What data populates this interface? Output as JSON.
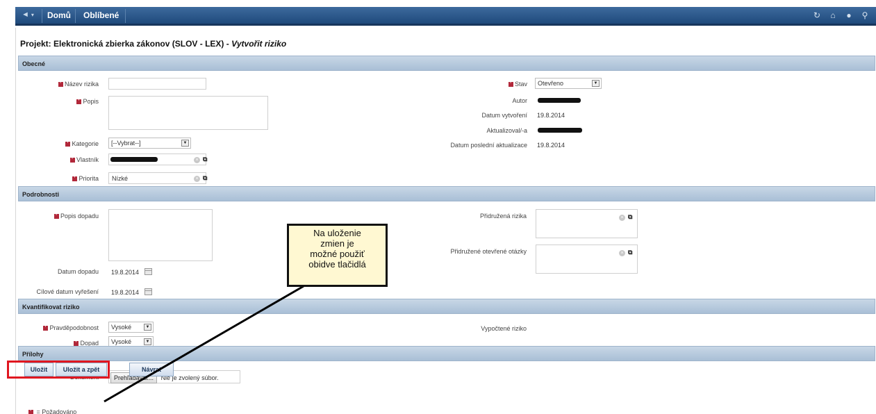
{
  "topbar": {
    "back_icon": "◄",
    "caret": "▾",
    "nav": [
      "Domů",
      "Oblíbené"
    ],
    "icons": [
      "refresh-icon",
      "home-icon",
      "help-icon",
      "search-icon"
    ]
  },
  "title": {
    "prefix": "Projekt: Elektronická zbierka zákonov (SLOV - LEX) - ",
    "action": "Vytvořit riziko"
  },
  "sections": {
    "general": "Obecné",
    "details": "Podrobnosti",
    "quantify": "Kvantifikovat riziko",
    "attachments": "Přílohy"
  },
  "general": {
    "name_label": "Název rizika",
    "name_value": "",
    "desc_label": "Popis",
    "desc_value": "",
    "category_label": "Kategorie",
    "category_value": "[--Vybrat--]",
    "owner_label": "Vlastník",
    "priority_label": "Priorita",
    "priority_value": "Nízké",
    "status_label": "Stav",
    "status_value": "Otevřeno",
    "author_label": "Autor",
    "created_label": "Datum vytvoření",
    "created_value": "19.8.2014",
    "updated_by_label": "Aktualizoval/-a",
    "last_update_label": "Datum poslední aktualizace",
    "last_update_value": "19.8.2014"
  },
  "details": {
    "impact_desc_label": "Popis dopadu",
    "impact_date_label": "Datum dopadu",
    "impact_date_value": "19.8.2014",
    "target_date_label": "Cílové datum vyřešení",
    "target_date_value": "19.8.2014",
    "assoc_risks_label": "Přidružená rizika",
    "assoc_questions_label": "Přidružené otevřené otázky"
  },
  "quantify": {
    "probability_label": "Pravděpodobnost",
    "probability_value": "Vysoké",
    "impact_label": "Dopad",
    "impact_value": "Vysoké",
    "computed_label": "Vypočtené riziko"
  },
  "attachments": {
    "document_label": "Dokument",
    "browse_label": "Prehľadávať...",
    "no_file": "Nie je zvolený súbor."
  },
  "buttons": {
    "save": "Uložit",
    "save_back": "Uložit a zpět",
    "return": "Návrat"
  },
  "required_note": "= Požadováno",
  "callout": {
    "lines": [
      "Na uloženie",
      "zmien je",
      "možné použiť",
      "obidve tlačidlá"
    ]
  },
  "colors": {
    "header": "#1f4a7c",
    "section": "#b9cbdf",
    "required": "#b1283a",
    "highlight": "#e0161f",
    "callout_bg": "#fff8d2"
  }
}
